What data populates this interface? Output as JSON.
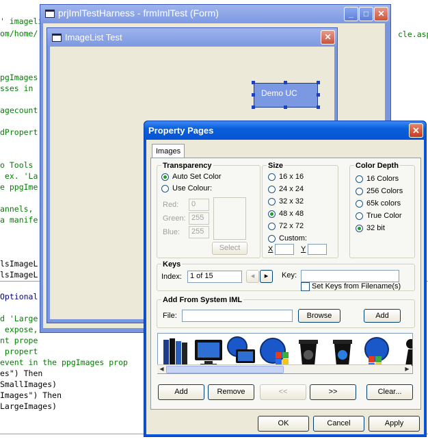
{
  "code_lines": [
    "' imageli",
    "om/home/",
    "",
    "",
    "pgImages",
    "sses in",
    "",
    "agecount",
    "",
    "dPropert",
    "",
    "",
    "o Tools",
    " ex. 'La",
    "e ppgIme",
    "",
    "annels,",
    "a manife",
    "",
    "",
    "",
    "lsImageL",
    "lsImageL",
    "",
    "Optional",
    "",
    "d 'Large",
    " expose,",
    "nt prope",
    " propert",
    "event in the ppgImages prop",
    "es\") Then",
    "SmallImages)",
    "Images\") Then",
    "LargeImages)"
  ],
  "code_right_text": "cle.asp",
  "outer_window": {
    "title": "prjImlTestHarness - frmImlTest (Form)"
  },
  "inner_window": {
    "title": "ImageList Test",
    "demo_uc_label": "Demo UC"
  },
  "dialog": {
    "title": "Property Pages",
    "tab_label": "Images",
    "transparency": {
      "legend": "Transparency",
      "auto_set_color": "Auto Set Color",
      "use_colour": "Use Colour:",
      "red_label": "Red:",
      "red_value": "0",
      "green_label": "Green:",
      "green_value": "255",
      "blue_label": "Blue:",
      "blue_value": "255",
      "select_button": "Select"
    },
    "size": {
      "legend": "Size",
      "options": [
        "16 x 16",
        "24 x 24",
        "32 x 32",
        "48 x 48",
        "72 x 72",
        "Custom:"
      ],
      "selected": "48 x 48",
      "x_label": "X",
      "y_label": "Y"
    },
    "color_depth": {
      "legend": "Color Depth",
      "options": [
        "16 Colors",
        "256 Colors",
        "65k colors",
        "True Color",
        "32 bit"
      ],
      "selected": "32 bit"
    },
    "keys": {
      "legend": "Keys",
      "index_label": "Index:",
      "index_value": "1 of 15",
      "key_label": "Key:",
      "key_value": "",
      "set_keys_label": "Set Keys from Filename(s)"
    },
    "add_from_iml": {
      "legend": "Add From System IML",
      "file_label": "File:",
      "file_value": "",
      "browse_button": "Browse",
      "add_button": "Add"
    },
    "image_strip": {
      "icons": [
        "books-icon",
        "monitor-icon",
        "globe-monitor-icon",
        "windows-globe-icon",
        "recycle-bin-empty-icon",
        "recycle-bin-full-icon",
        "globe-windows-icon",
        "chess-pawn-icon"
      ]
    },
    "strip_buttons": {
      "add": "Add",
      "remove": "Remove",
      "prev": "<<",
      "next": ">>",
      "clear": "Clear..."
    },
    "footer_buttons": {
      "ok": "OK",
      "cancel": "Cancel",
      "apply": "Apply"
    }
  },
  "colors": {
    "xp_blue_title": "#0554d6",
    "dialog_bg": "#ece9d8",
    "code_green": "#008000",
    "code_blue": "#000080"
  }
}
